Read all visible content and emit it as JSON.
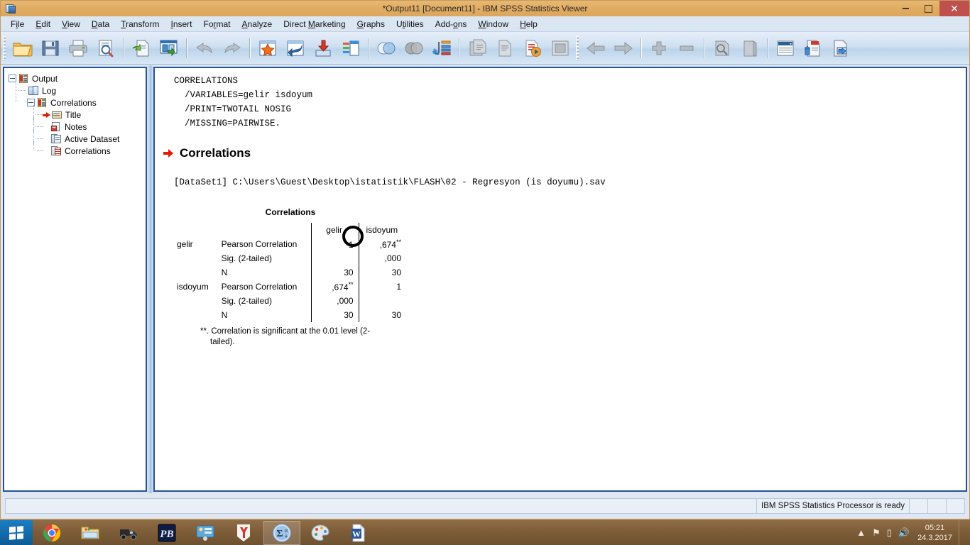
{
  "window": {
    "title": "*Output11 [Document11] - IBM SPSS Statistics Viewer",
    "icon": "spss-viewer-icon",
    "controls": {
      "minimize": "minimize",
      "maximize": "maximize",
      "close": "close"
    }
  },
  "menubar": {
    "items": [
      {
        "label": "File",
        "pre": "F",
        "hot": "i",
        "post": "le"
      },
      {
        "label": "Edit",
        "pre": "",
        "hot": "E",
        "post": "dit"
      },
      {
        "label": "View",
        "pre": "",
        "hot": "V",
        "post": "iew"
      },
      {
        "label": "Data",
        "pre": "",
        "hot": "D",
        "post": "ata"
      },
      {
        "label": "Transform",
        "pre": "",
        "hot": "T",
        "post": "ransform"
      },
      {
        "label": "Insert",
        "pre": "",
        "hot": "I",
        "post": "nsert"
      },
      {
        "label": "Format",
        "pre": "Fo",
        "hot": "r",
        "post": "mat"
      },
      {
        "label": "Analyze",
        "pre": "",
        "hot": "A",
        "post": "nalyze"
      },
      {
        "label": "Direct Marketing",
        "pre": "Direct ",
        "hot": "M",
        "post": "arketing"
      },
      {
        "label": "Graphs",
        "pre": "",
        "hot": "G",
        "post": "raphs"
      },
      {
        "label": "Utilities",
        "pre": "U",
        "hot": "t",
        "post": "ilities"
      },
      {
        "label": "Add-ons",
        "pre": "Add-",
        "hot": "o",
        "post": "ns"
      },
      {
        "label": "Window",
        "pre": "",
        "hot": "W",
        "post": "indow"
      },
      {
        "label": "Help",
        "pre": "",
        "hot": "H",
        "post": "elp"
      }
    ]
  },
  "toolbar": {
    "group1": [
      "open-file-icon",
      "save-file-icon",
      "print-icon",
      "print-preview-icon",
      "export-icon",
      "dialog-recall-icon",
      "undo-icon",
      "redo-icon",
      "goto-data-icon",
      "goto-case-icon",
      "insert-data-icon",
      "variables-icon",
      "run-descriptives-icon",
      "select-cases-icon",
      "split-file-icon",
      "weight-cases-icon",
      "value-labels-icon",
      "use-sets-icon",
      "show-all-icon"
    ],
    "group2": [
      "back-icon",
      "forward-icon",
      "promote-icon",
      "demote-icon",
      "collapse-icon",
      "expand-icon",
      "show-hide-icon",
      "insert-title-icon",
      "insert-text-icon"
    ]
  },
  "outline": {
    "root": {
      "label": "Output",
      "icon": "output-icon",
      "expanded": true
    },
    "items": [
      {
        "label": "Log",
        "icon": "log-icon",
        "level": 1,
        "selected": false
      },
      {
        "label": "Correlations",
        "icon": "output-icon",
        "level": 1,
        "selected": false,
        "expanded": true
      },
      {
        "label": "Title",
        "icon": "title-icon",
        "level": 2,
        "selected": true
      },
      {
        "label": "Notes",
        "icon": "notes-icon",
        "level": 2,
        "selected": false
      },
      {
        "label": "Active Dataset",
        "icon": "active-dataset-icon",
        "level": 2,
        "selected": false
      },
      {
        "label": "Correlations",
        "icon": "table-icon",
        "level": 2,
        "selected": false
      }
    ]
  },
  "output": {
    "syntax": "CORRELATIONS\n  /VARIABLES=gelir isdoyum\n  /PRINT=TWOTAIL NOSIG\n  /MISSING=PAIRWISE.",
    "section_title": "Correlations",
    "dataset_line": "[DataSet1] C:\\Users\\Guest\\Desktop\\istatistik\\FLASH\\02 - Regresyon (is doyumu).sav",
    "table": {
      "caption": "Correlations",
      "column_headers": [
        "",
        "",
        "gelir",
        "isdoyum"
      ],
      "rows": [
        {
          "var": "gelir",
          "stat": "Pearson Correlation",
          "gelir": "1",
          "isdoyum": ",674",
          "isdoyum_sup": "**",
          "gelir_sup": ""
        },
        {
          "var": "",
          "stat": "Sig. (2-tailed)",
          "gelir": "",
          "isdoyum": ",000",
          "isdoyum_sup": "",
          "gelir_sup": ""
        },
        {
          "var": "",
          "stat": "N",
          "gelir": "30",
          "isdoyum": "30",
          "isdoyum_sup": "",
          "gelir_sup": ""
        },
        {
          "var": "isdoyum",
          "stat": "Pearson Correlation",
          "gelir": ",674",
          "isdoyum": "1",
          "isdoyum_sup": "",
          "gelir_sup": "**"
        },
        {
          "var": "",
          "stat": "Sig. (2-tailed)",
          "gelir": ",000",
          "isdoyum": "",
          "isdoyum_sup": "",
          "gelir_sup": ""
        },
        {
          "var": "",
          "stat": "N",
          "gelir": "30",
          "isdoyum": "30",
          "isdoyum_sup": "",
          "gelir_sup": ""
        }
      ],
      "footnote_line1": "**. Correlation is significant at the 0.01 level (2-",
      "footnote_line2": "tailed)."
    },
    "annotation": {
      "type": "circle-highlight",
      "target": "gelir-gelir-pearson-cell"
    }
  },
  "statusbar": {
    "message": "IBM SPSS Statistics Processor is ready"
  },
  "taskbar": {
    "start": "windows-start-icon",
    "items": [
      {
        "name": "chrome",
        "icon": "chrome-icon",
        "active": false
      },
      {
        "name": "file-explorer",
        "icon": "file-explorer-icon",
        "active": false
      },
      {
        "name": "truck-app",
        "icon": "truck-icon",
        "active": false
      },
      {
        "name": "pb-app",
        "icon": "pb-icon",
        "active": false
      },
      {
        "name": "utility-app",
        "icon": "utility-icon",
        "active": false
      },
      {
        "name": "yandex",
        "icon": "yandex-icon",
        "active": false
      },
      {
        "name": "spss",
        "icon": "spss-icon",
        "active": true
      },
      {
        "name": "paint",
        "icon": "paint-icon",
        "active": false
      },
      {
        "name": "word",
        "icon": "word-icon",
        "active": false
      }
    ],
    "tray": {
      "chevron": "show-hidden-icons-icon",
      "flag": "action-center-icon",
      "battery": "battery-icon",
      "volume": "volume-icon"
    },
    "clock": {
      "time": "05:21",
      "date": "24.3.2017"
    }
  },
  "colors": {
    "titlebar": "#e0ac63",
    "close_button": "#c0504d",
    "accent_red": "#e01b00",
    "pane_border": "#27519b",
    "toolbar_bg": "#cfe0f1"
  }
}
